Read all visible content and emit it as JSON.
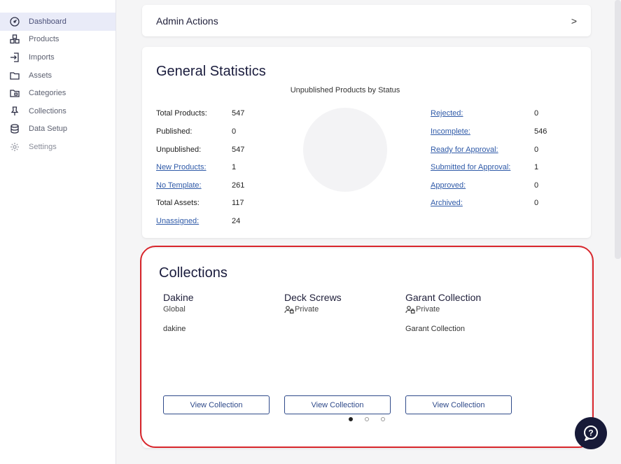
{
  "sidebar": {
    "items": [
      {
        "label": "Dashboard",
        "icon": "dashboard-icon",
        "active": true
      },
      {
        "label": "Products",
        "icon": "boxes-icon"
      },
      {
        "label": "Imports",
        "icon": "import-icon"
      },
      {
        "label": "Assets",
        "icon": "folder-icon"
      },
      {
        "label": "Categories",
        "icon": "categories-icon"
      },
      {
        "label": "Collections",
        "icon": "pin-icon"
      },
      {
        "label": "Data Setup",
        "icon": "database-icon"
      },
      {
        "label": "Settings",
        "icon": "gear-icon"
      }
    ]
  },
  "admin": {
    "title": "Admin Actions",
    "chevron": ">"
  },
  "stats": {
    "title": "General Statistics",
    "chart_title": "Unpublished Products by Status",
    "left": [
      {
        "label": "Total Products:",
        "value": "547",
        "link": false
      },
      {
        "label": "Published:",
        "value": "0",
        "link": false
      },
      {
        "label": "Unpublished:",
        "value": "547",
        "link": false
      },
      {
        "label": "New Products:",
        "value": "1",
        "link": true
      },
      {
        "label": "No Template:",
        "value": "261",
        "link": true
      },
      {
        "label": "Total Assets:",
        "value": "117",
        "link": false
      },
      {
        "label": "Unassigned:",
        "value": "24",
        "link": true
      }
    ],
    "right": [
      {
        "label": "Rejected:",
        "value": "0"
      },
      {
        "label": "Incomplete:",
        "value": "546"
      },
      {
        "label": "Ready for Approval:",
        "value": "0"
      },
      {
        "label": "Submitted for Approval:",
        "value": "1"
      },
      {
        "label": "Approved:",
        "value": "0"
      },
      {
        "label": "Archived:",
        "value": "0"
      }
    ]
  },
  "collections": {
    "title": "Collections",
    "items": [
      {
        "name": "Dakine",
        "scope": "Global",
        "description": "dakine",
        "button": "View Collection",
        "private": false
      },
      {
        "name": "Deck Screws",
        "scope": "Private",
        "description": "",
        "button": "View Collection",
        "private": true
      },
      {
        "name": "Garant Collection",
        "scope": "Private",
        "description": "Garant Collection",
        "button": "View Collection",
        "private": true
      }
    ],
    "pagination": {
      "pages": 3,
      "current": 1
    }
  },
  "colors": {
    "accent": "#2f4a8a",
    "highlight": "#d8262c",
    "help": "#171a38"
  }
}
